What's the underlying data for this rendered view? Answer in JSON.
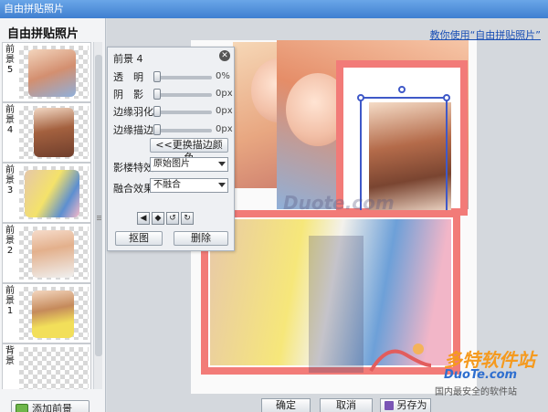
{
  "window": {
    "title": "自由拼贴照片"
  },
  "sidebar": {
    "title": "自由拼贴照片",
    "items": [
      {
        "label": "前景5"
      },
      {
        "label": "前景4"
      },
      {
        "label": "前景3"
      },
      {
        "label": "前景2"
      },
      {
        "label": "前景1"
      },
      {
        "label": "背景"
      }
    ],
    "add_button": "添加前景"
  },
  "main": {
    "help_link": "教你使用“自由拼贴照片”",
    "watermark_center": "Duote.com",
    "watermarks": [
      "多特软件站",
      "DuoTe.com",
      "国内最安全的软件站"
    ]
  },
  "properties": {
    "title": "前景 4",
    "rows": [
      {
        "label": "透　明",
        "value": "0%"
      },
      {
        "label": "阴　影",
        "value": "0px"
      },
      {
        "label": "边缘羽化",
        "value": "0px"
      },
      {
        "label": "边缘描边",
        "value": "0px"
      }
    ],
    "change_border_color": "<<更换描边颜色",
    "shadow_effect_label": "影楼特效",
    "shadow_effect_value": "原始图片",
    "blend_label": "融合效果",
    "blend_value": "不融合",
    "cutout_button": "抠图",
    "delete_button": "删除"
  },
  "footer": {
    "ok": "确定",
    "cancel": "取消",
    "save_as": "另存为"
  }
}
